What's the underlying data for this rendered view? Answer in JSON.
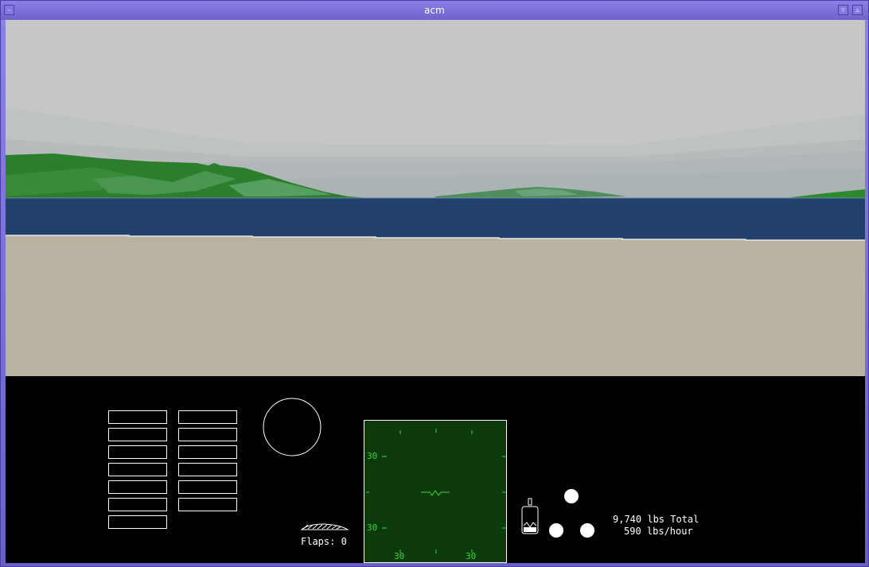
{
  "window": {
    "title": "acm",
    "menu_icon": "window-menu-icon",
    "minimize_icon": "minimize-icon",
    "maximize_icon": "maximize-icon"
  },
  "scene": {
    "sky_color": "#c6c6c6",
    "haze_color": "#b8bcbc",
    "water_color": "#21406c",
    "ground_color": "#b8b2a0",
    "terrain_color": "#2c7a2c"
  },
  "panel": {
    "flaps_label": "Flaps: 0",
    "fuel_total": "9,740 lbs Total",
    "fuel_rate": "590 lbs/hour",
    "hud": {
      "background": "#0c3a0c",
      "left_scale_top": "30",
      "left_scale_bottom": "30",
      "bottom_scale_left": "30",
      "bottom_scale_right": "30"
    },
    "colors": {
      "hud_green": "#3ad43a",
      "gauge_white": "#ffffff"
    }
  }
}
